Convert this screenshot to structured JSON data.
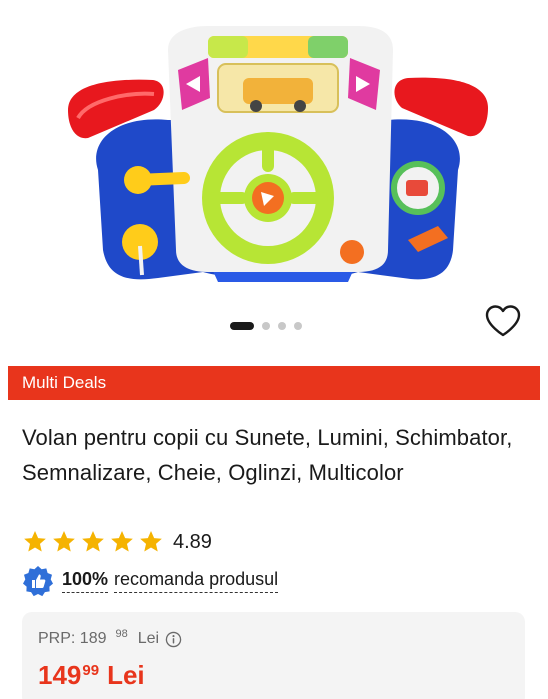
{
  "product": {
    "vendor": "Multi Deals",
    "title": "Volan pentru copii cu Sunete, Lumini, Schimbator, Semnalizare, Cheie, Oglinzi, Multicolor",
    "rating": "4.89",
    "stars": 5,
    "recommend_pct": "100%",
    "recommend_text": "recomanda produsul"
  },
  "gallery": {
    "image_count": 4,
    "active_index": 0
  },
  "price": {
    "prp_label": "PRP: 189",
    "prp_decimals": "98",
    "prp_currency": "Lei",
    "current_int": "149",
    "current_decimals": "99",
    "current_currency": "Lei"
  },
  "colors": {
    "accent": "#e8351c",
    "star": "#f5b301",
    "recommend_badge": "#2f6fd8"
  },
  "icons": [
    "heart-icon",
    "star-icon",
    "thumbs-up-icon",
    "info-icon"
  ]
}
